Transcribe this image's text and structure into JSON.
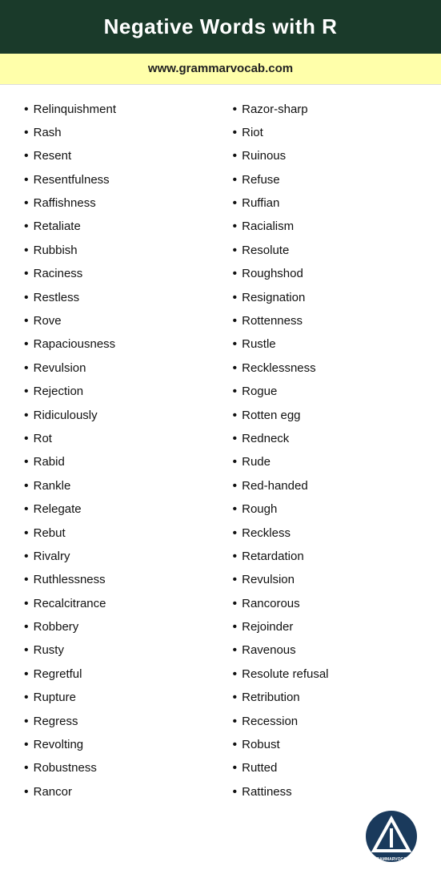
{
  "header": {
    "title": "Negative Words with R"
  },
  "url_bar": {
    "url": "www.grammarvocab.com"
  },
  "left_column": {
    "items": [
      "Relinquishment",
      "Rash",
      "Resent",
      "Resentfulness",
      "Raffishness",
      "Retaliate",
      "Rubbish",
      "Raciness",
      "Restless",
      "Rove",
      "Rapaciousness",
      "Revulsion",
      "Rejection",
      "Ridiculously",
      "Rot",
      "Rabid",
      "Rankle",
      "Relegate",
      "Rebut",
      "Rivalry",
      "Ruthlessness",
      "Recalcitrance",
      "Robbery",
      "Rusty",
      "Regretful",
      "Rupture",
      "Regress",
      "Revolting",
      "Robustness",
      "Rancor"
    ]
  },
  "right_column": {
    "items": [
      "Razor-sharp",
      "Riot",
      "Ruinous",
      "Refuse",
      "Ruffian",
      "Racialism",
      "Resolute",
      "Roughshod",
      "Resignation",
      "Rottenness",
      "Rustle",
      "Recklessness",
      "Rogue",
      "Rotten egg",
      "Redneck",
      "Rude",
      "Red-handed",
      "Rough",
      "Reckless",
      "Retardation",
      "Revulsion",
      "Rancorous",
      "Rejoinder",
      "Ravenous",
      "Resolute refusal",
      "Retribution",
      "Recession",
      "Robust",
      "Rutted",
      "Rattiness"
    ]
  }
}
